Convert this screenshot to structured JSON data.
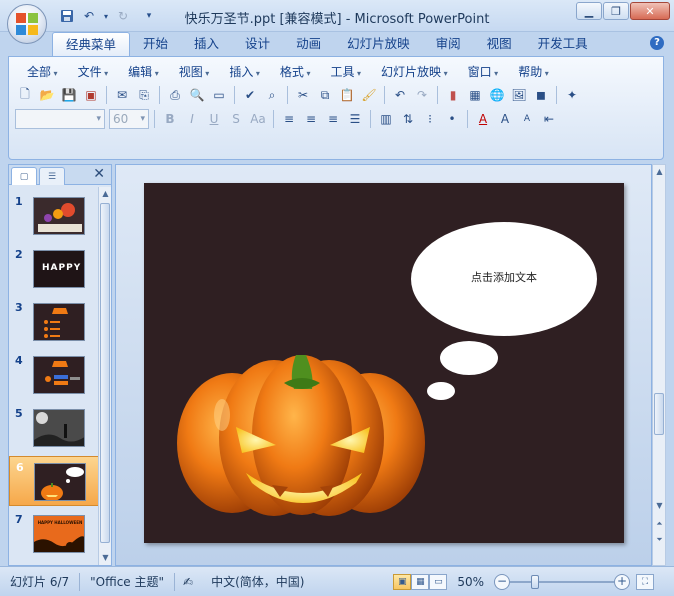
{
  "window": {
    "title": "快乐万圣节.ppt [兼容模式] - Microsoft PowerPoint",
    "controls": [
      "minimize-icon",
      "maximize-icon",
      "close-icon"
    ]
  },
  "quick_access": [
    "save-icon",
    "undo-icon",
    "redo-icon",
    "customize-icon"
  ],
  "tabs": [
    {
      "label": "经典菜单",
      "active": true
    },
    {
      "label": "开始"
    },
    {
      "label": "插入"
    },
    {
      "label": "设计"
    },
    {
      "label": "动画"
    },
    {
      "label": "幻灯片放映"
    },
    {
      "label": "审阅"
    },
    {
      "label": "视图"
    },
    {
      "label": "开发工具"
    }
  ],
  "menubar": [
    "全部",
    "文件",
    "编辑",
    "视图",
    "插入",
    "格式",
    "工具",
    "幻灯片放映",
    "窗口",
    "帮助"
  ],
  "format_bar": {
    "font_name": "",
    "font_size": "60"
  },
  "slides": [
    {
      "number": "1"
    },
    {
      "number": "2",
      "thumb_text": "HAPPY"
    },
    {
      "number": "3"
    },
    {
      "number": "4"
    },
    {
      "number": "5"
    },
    {
      "number": "6",
      "selected": true
    },
    {
      "number": "7",
      "thumb_text": "HAPPY HALLOWEEN"
    }
  ],
  "current_slide": {
    "bubble_placeholder": "点击添加文本",
    "background_color": "#2f1f22"
  },
  "statusbar": {
    "slide_position": "幻灯片 6/7",
    "theme": "\"Office 主题\"",
    "language": "中文(简体，中国)",
    "zoom": "50%",
    "zoom_percent": 50
  },
  "colors": {
    "accent": "#15428b",
    "selected_thumb": "#f6a84a",
    "pumpkin": "#f07a14"
  }
}
